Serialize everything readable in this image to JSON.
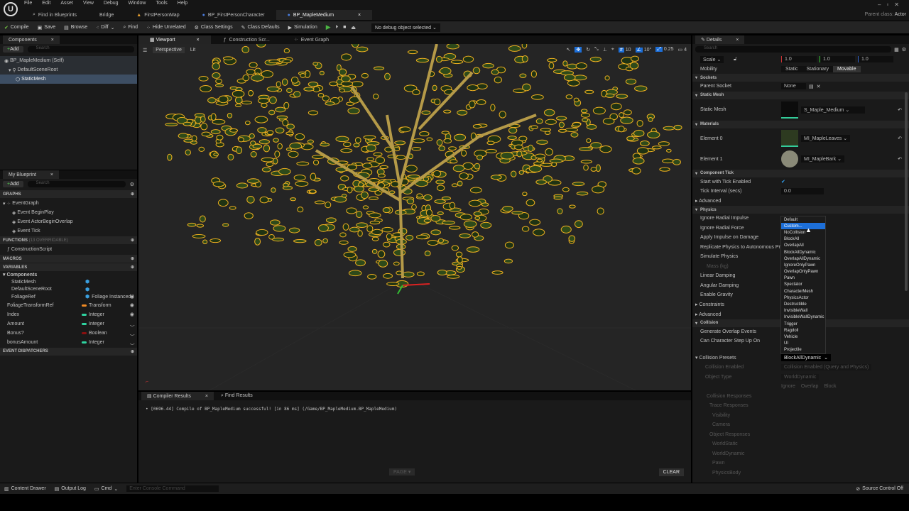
{
  "menu": [
    "File",
    "Edit",
    "Asset",
    "View",
    "Debug",
    "Window",
    "Tools",
    "Help"
  ],
  "tabs": [
    {
      "label": "Find in Blueprints",
      "icon": "search-icon"
    },
    {
      "label": "Bridge",
      "icon": ""
    },
    {
      "label": "FirstPersonMap",
      "icon": "map-icon"
    },
    {
      "label": "BP_FirstPersonCharacter",
      "icon": "blueprint-icon"
    },
    {
      "label": "BP_MapleMedium",
      "icon": "blueprint-icon",
      "active": true
    }
  ],
  "parent_class": {
    "label": "Parent class:",
    "value": "Actor"
  },
  "toolbar": {
    "compile": "Compile",
    "save": "Save",
    "browse": "Browse",
    "diff": "Diff",
    "find": "Find",
    "hide_unrelated": "Hide Unrelated",
    "class_settings": "Class Settings",
    "class_defaults": "Class Defaults",
    "simulation": "Simulation",
    "debug_object": "No debug object selected"
  },
  "components": {
    "title": "Components",
    "add": "Add",
    "search_placeholder": "Search",
    "tree": [
      "BP_MapleMedium (Self)",
      "DefaultSceneRoot",
      "StaticMesh"
    ]
  },
  "my_blueprint": {
    "title": "My Blueprint",
    "add": "Add",
    "search_placeholder": "Search",
    "graphs_header": "GRAPHS",
    "event_graph": "EventGraph",
    "events": [
      "Event BeginPlay",
      "Event ActorBeginOverlap",
      "Event Tick"
    ],
    "functions_header": "FUNCTIONS",
    "functions_note": "(13 OVERRIDABLE)",
    "functions": [
      "ConstructionScript"
    ],
    "macros_header": "MACROS",
    "variables_header": "VARIABLES",
    "components_group": "Components",
    "component_vars": [
      {
        "name": "StaticMesh",
        "type": ""
      },
      {
        "name": "DefaultSceneRoot",
        "type": ""
      },
      {
        "name": "FoliageRef",
        "type": "Foliage Instanced !",
        "color": "#3aa0e0"
      }
    ],
    "variables": [
      {
        "name": "FoliageTransformRef",
        "type": "Transform",
        "color": "#f08a24"
      },
      {
        "name": "Index",
        "type": "Integer",
        "color": "#2fd3a0"
      },
      {
        "name": "Amount",
        "type": "Integer",
        "color": "#2fd3a0"
      },
      {
        "name": "Bonus?",
        "type": "Boolean",
        "color": "#8a1010"
      },
      {
        "name": "bonusAmount",
        "type": "Integer",
        "color": "#2fd3a0"
      }
    ],
    "dispatchers_header": "EVENT DISPATCHERS"
  },
  "viewport": {
    "tabs": [
      "Viewport",
      "Construction Scr...",
      "Event Graph"
    ],
    "perspective": "Perspective",
    "lit": "Lit",
    "grid_snap": "10",
    "rot_snap": "10°",
    "scale_snap": "0.25",
    "camera_speed": "4"
  },
  "compiler": {
    "tabs": [
      "Compiler Results",
      "Find Results"
    ],
    "message": "[0696.44] Compile of BP_MapleMedium successful! [in 86 ms] (/Game/BP_MapleMedium.BP_MapleMedium)",
    "page": "PAGE",
    "clear": "CLEAR"
  },
  "details": {
    "title": "Details",
    "search_placeholder": "Search",
    "scale_label": "Scale",
    "scale": [
      "1.0",
      "1.0",
      "1.0"
    ],
    "mobility_label": "Mobility",
    "mobility": [
      "Static",
      "Stationary",
      "Movable"
    ],
    "sockets": "Sockets",
    "parent_socket": "Parent Socket",
    "parent_socket_value": "None",
    "static_mesh_section": "Static Mesh",
    "static_mesh_label": "Static Mesh",
    "static_mesh_value": "S_Maple_Medium",
    "materials": "Materials",
    "element0": "Element 0",
    "element0_value": "MI_MapleLeaves",
    "element1": "Element 1",
    "element1_value": "MI_MapleBark",
    "component_tick": "Component Tick",
    "start_tick": "Start with Tick Enabled",
    "tick_interval": "Tick Interval (secs)",
    "tick_interval_value": "0.0",
    "advanced": "Advanced",
    "physics": "Physics",
    "physics_rows": [
      "Ignore Radial Impulse",
      "Ignore Radial Force",
      "Apply Impulse on Damage",
      "Replicate Physics to Autonomous Proxy",
      "Simulate Physics",
      "Mass (kg)",
      "Linear Damping",
      "Angular Damping",
      "Enable Gravity"
    ],
    "constraints": "Constraints",
    "advanced2": "Advanced",
    "collision": "Collision",
    "generate_overlap": "Generate Overlap Events",
    "can_step": "Can Character Step Up On",
    "collision_presets": "Collision Presets",
    "collision_presets_value": "BlockAllDynamic",
    "collision_enabled": "Collision Enabled",
    "collision_enabled_value": "Collision Enabled (Query and Physics)",
    "object_type": "Object Type",
    "object_type_value": "WorldDynamic",
    "resp_cols": [
      "Ignore",
      "Overlap",
      "Block"
    ],
    "collision_responses": "Collision Responses",
    "trace_responses": "Trace Responses",
    "trace": [
      "Visibility",
      "Camera"
    ],
    "object_responses": "Object Responses",
    "objects": [
      "WorldStatic",
      "WorldDynamic",
      "Pawn",
      "PhysicsBody"
    ]
  },
  "dropdown": {
    "options": [
      "Default",
      "Custom...",
      "NoCollision",
      "BlockAll",
      "OverlapAll",
      "BlockAllDynamic",
      "OverlapAllDynamic",
      "IgnoreOnlyPawn",
      "OverlapOnlyPawn",
      "Pawn",
      "Spectator",
      "CharacterMesh",
      "PhysicsActor",
      "Destructible",
      "InvisibleWall",
      "InvisibleWallDynamic",
      "Trigger",
      "Ragdoll",
      "Vehicle",
      "UI",
      "Projectile"
    ],
    "selected": "Custom..."
  },
  "statusbar": {
    "content_drawer": "Content Drawer",
    "output_log": "Output Log",
    "cmd": "Cmd",
    "console_placeholder": "Enter Console Command",
    "source_control": "Source Control Off"
  },
  "colors": {
    "accent": "#1d6fd8",
    "outline": "#f0b020",
    "panel": "#1a1a1a"
  }
}
